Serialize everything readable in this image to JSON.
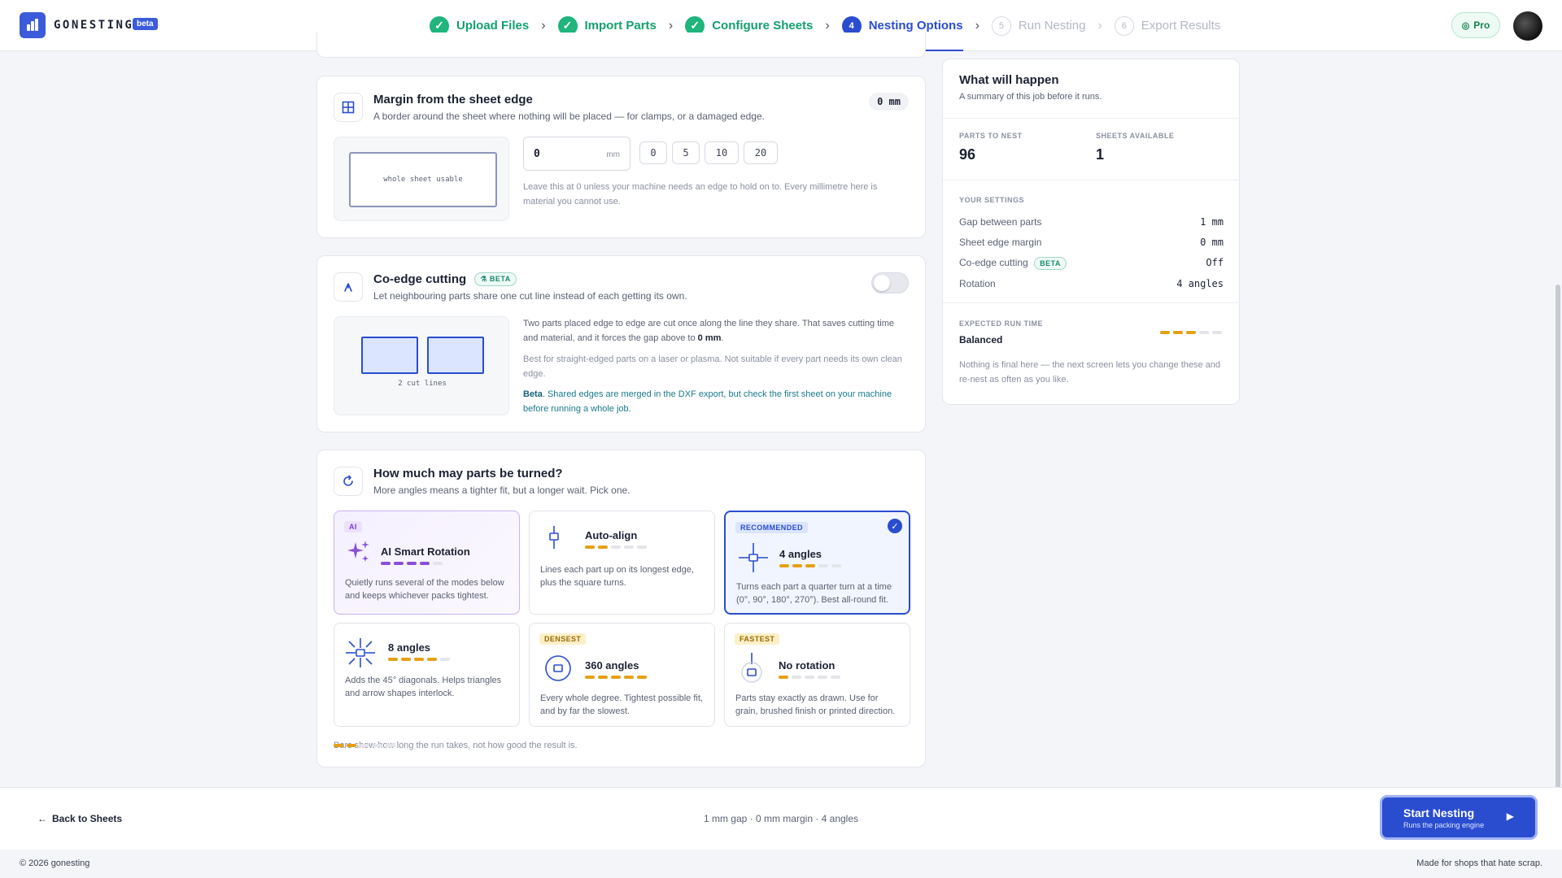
{
  "app": {
    "brand": "GONESTING",
    "badge": "beta",
    "plan": "Pro"
  },
  "steps": [
    {
      "label": "Upload Files",
      "state": "done",
      "num": "1"
    },
    {
      "label": "Import Parts",
      "state": "done",
      "num": "2"
    },
    {
      "label": "Configure Sheets",
      "state": "done",
      "num": "3"
    },
    {
      "label": "Nesting Options",
      "state": "active",
      "num": "4"
    },
    {
      "label": "Run Nesting",
      "state": "todo",
      "num": "5"
    },
    {
      "label": "Export Results",
      "state": "todo",
      "num": "6"
    }
  ],
  "margin": {
    "title": "Margin from the sheet edge",
    "subtitle": "A border around the sheet where nothing will be placed — for clamps, or a damaged edge.",
    "value_display": "0 mm",
    "preview_label": "whole sheet usable",
    "input_value": "0",
    "unit": "mm",
    "presets": [
      "0",
      "5",
      "10",
      "20"
    ],
    "note": "Leave this at 0 unless your machine needs an edge to hold on to. Every millimetre here is material you cannot use."
  },
  "coedge": {
    "title": "Co-edge cutting",
    "badge": "BETA",
    "subtitle": "Let neighbouring parts share one cut line instead of each getting its own.",
    "enabled": false,
    "preview_label": "2 cut lines",
    "p1_a": "Two parts placed edge to edge are cut once along the line they share. That saves cutting time",
    "p1_b": "and material, and it forces the gap above to ",
    "p1_bold": "0 mm",
    "p1_end": ".",
    "p2": "Best for straight-edged parts on a laser or plasma. Not suitable if every part needs its own clean edge.",
    "p3_bold": "Beta",
    "p3": ". Shared edges are merged in the DXF export, but check the first sheet on your machine before running a whole job."
  },
  "rotation": {
    "title": "How much may parts be turned?",
    "subtitle": "More angles means a tighter fit, but a longer wait. Pick one.",
    "options": [
      {
        "tag": "AI",
        "title": "AI Smart Rotation",
        "bars": 4,
        "desc": "Quietly runs several of the modes below and keeps whichever packs tightest.",
        "icon": "sparkle-icon"
      },
      {
        "tag": "",
        "title": "Auto-align",
        "bars": 2,
        "desc": "Lines each part up on its longest edge, plus the square turns.",
        "icon": "align-icon"
      },
      {
        "tag": "RECOMMENDED",
        "title": "4 angles",
        "bars": 3,
        "desc": "Turns each part a quarter turn at a time (0°, 90°, 180°, 270°). Best all-round fit.",
        "icon": "four-angle-icon",
        "selected": true
      },
      {
        "tag": "",
        "title": "8 angles",
        "bars": 4,
        "desc": "Adds the 45° diagonals. Helps triangles and arrow shapes interlock.",
        "icon": "eight-angle-icon"
      },
      {
        "tag": "DENSEST",
        "title": "360 angles",
        "bars": 5,
        "desc": "Every whole degree. Tightest possible fit, and by far the slowest.",
        "icon": "circle-angle-icon"
      },
      {
        "tag": "FASTEST",
        "title": "No rotation",
        "bars": 1,
        "desc": "Parts stay exactly as drawn. Use for grain, brushed finish or printed direction.",
        "icon": "no-rotation-icon"
      }
    ],
    "legend": "Bars show how long the run takes, not how good the result is."
  },
  "summary": {
    "title": "What will happen",
    "subtitle": "A summary of this job before it runs.",
    "parts_label": "PARTS TO NEST",
    "parts_value": "96",
    "sheets_label": "SHEETS AVAILABLE",
    "sheets_value": "1",
    "settings_label": "YOUR SETTINGS",
    "settings": [
      {
        "label": "Gap between parts",
        "value": "1 mm"
      },
      {
        "label": "Sheet edge margin",
        "value": "0 mm"
      },
      {
        "label": "Co-edge cutting",
        "value": "Off",
        "badge": "BETA"
      },
      {
        "label": "Rotation",
        "value": "4 angles"
      }
    ],
    "runtime_label": "EXPECTED RUN TIME",
    "runtime_value": "Balanced",
    "runtime_bars": 3,
    "footnote": "Nothing is final here — the next screen lets you change these and re-nest as often as you like."
  },
  "bottom": {
    "back_label": "Back to Sheets",
    "summary_line": "1 mm gap · 0 mm margin · 4 angles",
    "start_label": "Start Nesting",
    "start_sub": "Runs the packing engine"
  },
  "footer": {
    "copyright": "© 2026 gonesting",
    "tagline": "Made for shops that hate scrap."
  },
  "colors": {
    "primary": "#2a4dd0",
    "success": "#1fb57b",
    "amber": "#e5a013",
    "purple": "#8a4fd8"
  }
}
